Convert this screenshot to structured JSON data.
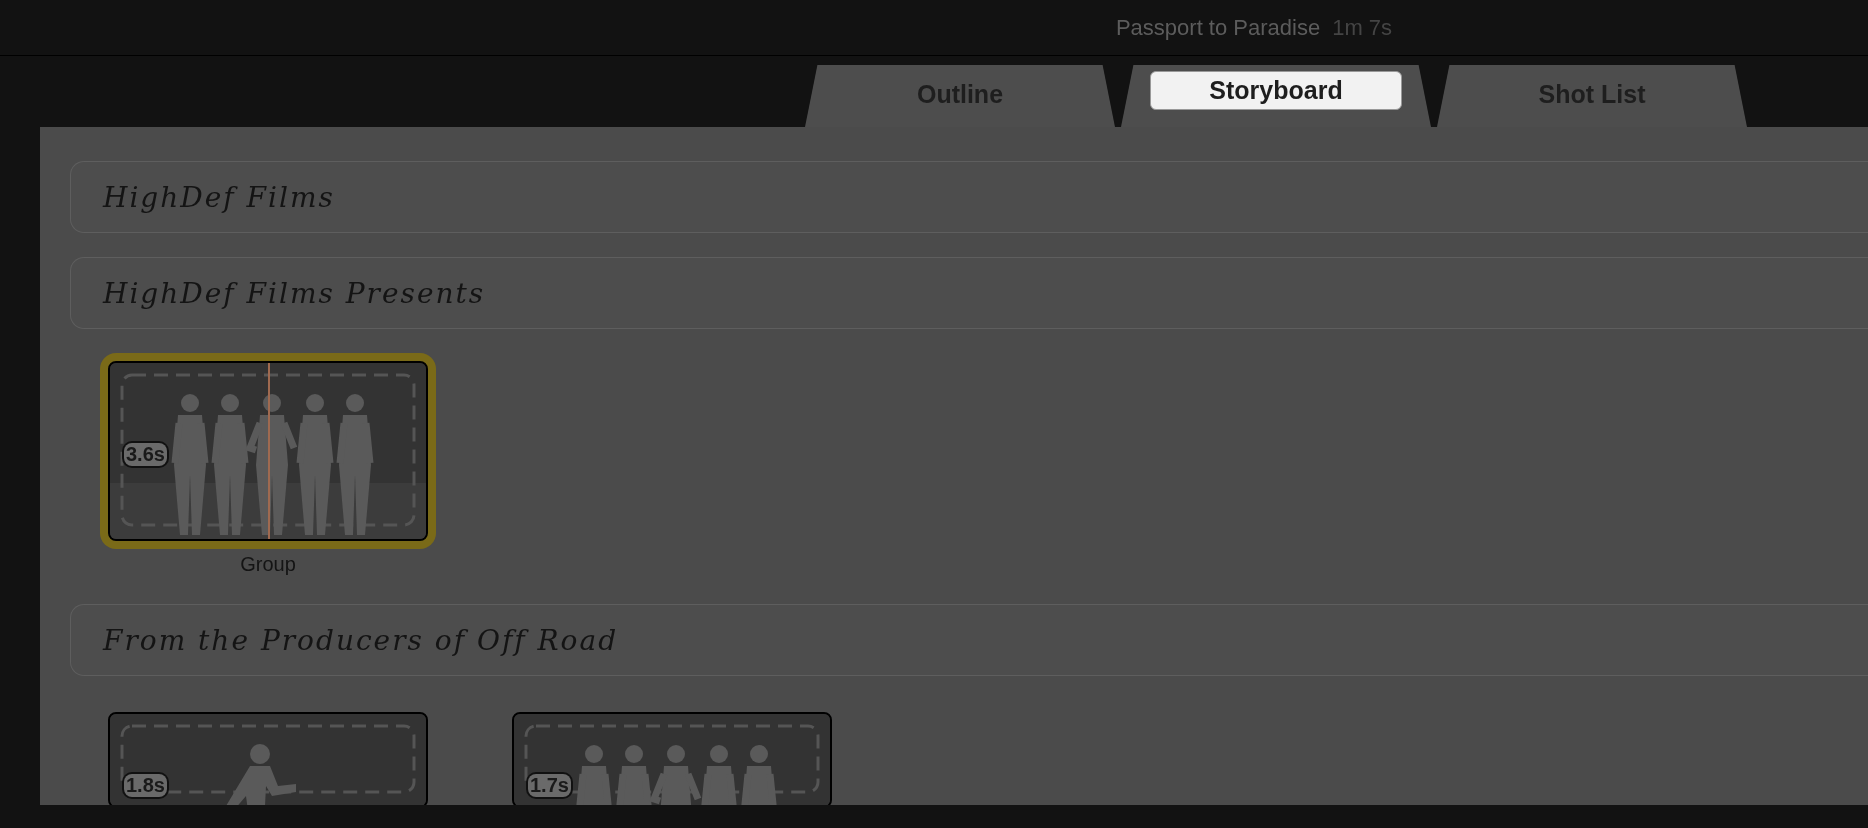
{
  "window": {
    "title": "Passport to Paradise",
    "duration": "1m 7s"
  },
  "tabs": [
    {
      "label": "Outline",
      "selected": false
    },
    {
      "label": "Storyboard",
      "selected": true
    },
    {
      "label": "Shot List",
      "selected": false
    }
  ],
  "sections": [
    {
      "title": "HighDef Films"
    },
    {
      "title": "HighDef Films Presents",
      "shots": [
        {
          "duration": "3.6s",
          "label": "Group",
          "selected": true,
          "playhead": true,
          "kind": "group"
        }
      ]
    },
    {
      "title": "From the Producers of Off Road",
      "shots": [
        {
          "duration": "1.8s",
          "selected": false,
          "playhead": false,
          "kind": "runner"
        },
        {
          "duration": "1.7s",
          "selected": false,
          "playhead": false,
          "kind": "group"
        }
      ]
    }
  ]
}
